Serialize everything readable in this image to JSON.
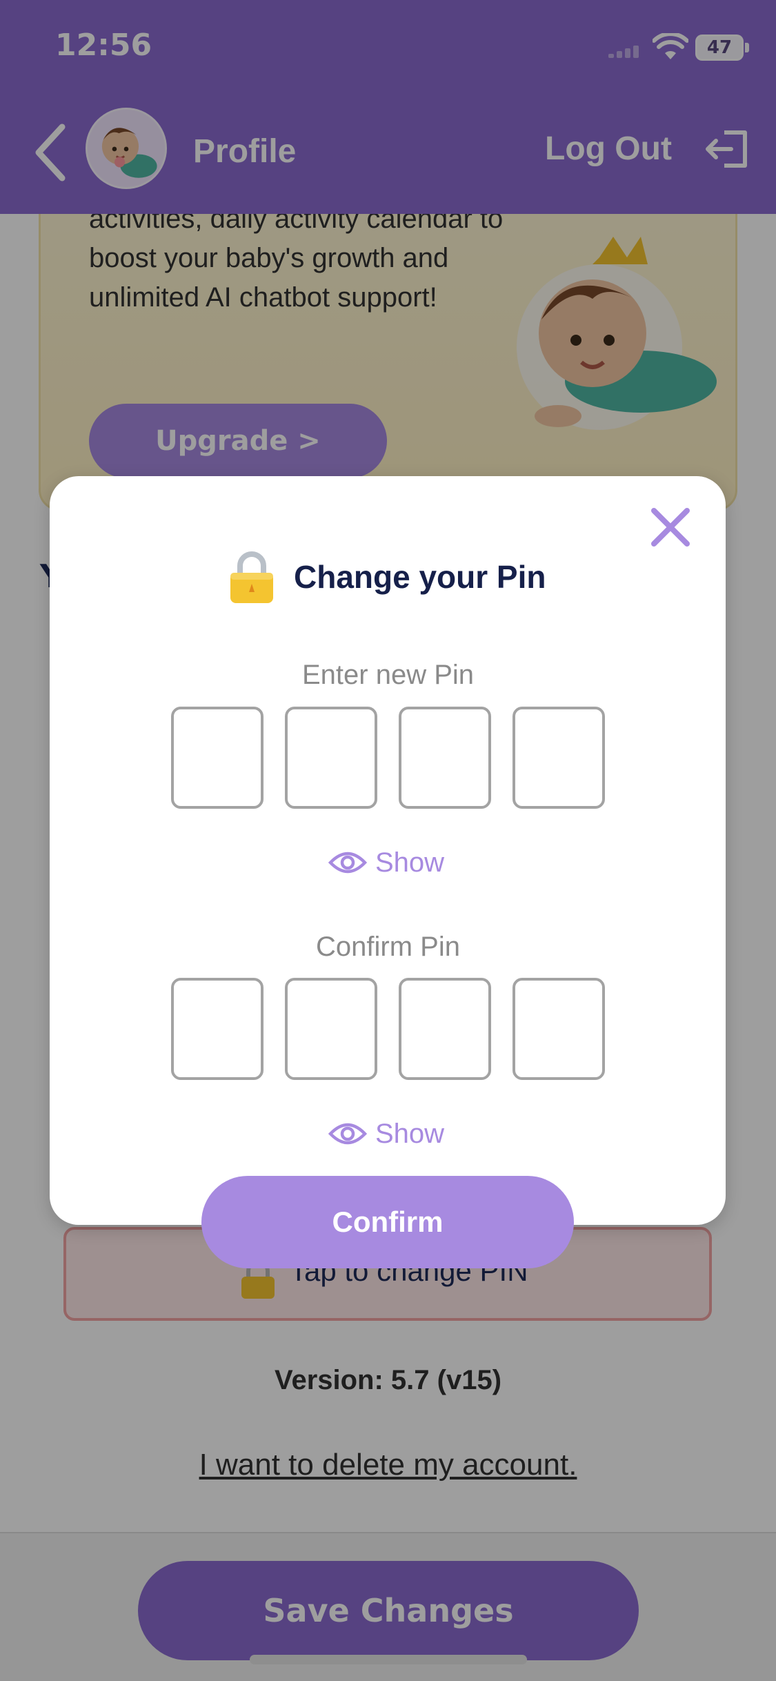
{
  "status_bar": {
    "time": "12:56",
    "battery": "47"
  },
  "header": {
    "title": "Profile",
    "logout_label": "Log Out"
  },
  "promo": {
    "text": "activities, daily activity calendar to boost your baby's growth and unlimited AI chatbot support!",
    "upgrade_label": "Upgrade >"
  },
  "section": {
    "partial_heading": "Y"
  },
  "pin_row": {
    "label": "Tap to change PIN"
  },
  "footer": {
    "version": "Version: 5.7 (v15)",
    "delete_link": "I want to delete my account.",
    "save_label": "Save Changes"
  },
  "modal": {
    "title": "Change your Pin",
    "new_pin_label": "Enter new Pin",
    "confirm_pin_label": "Confirm Pin",
    "show_label": "Show",
    "confirm_button": "Confirm",
    "new_pin_digits": [
      "",
      "",
      "",
      ""
    ],
    "confirm_pin_digits": [
      "",
      "",
      "",
      ""
    ]
  },
  "colors": {
    "header": "#8b6bd1",
    "accent": "#a78ae0",
    "title_text": "#16204a",
    "pin_border": "#a3a3a3"
  },
  "icons": [
    "back-chevron-icon",
    "baby-avatar-icon",
    "logout-icon",
    "close-icon",
    "lock-icon",
    "eye-icon"
  ]
}
